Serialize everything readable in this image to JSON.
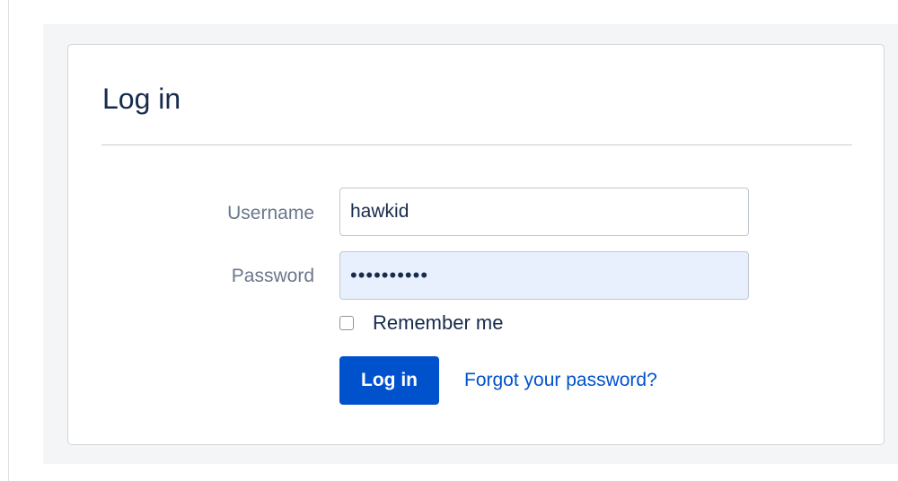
{
  "login": {
    "title": "Log in",
    "username_label": "Username",
    "username_value": "hawkid",
    "password_label": "Password",
    "password_value": "••••••••••",
    "remember_label": "Remember me",
    "remember_checked": false,
    "submit_label": "Log in",
    "forgot_link": "Forgot your password?"
  },
  "colors": {
    "primary": "#0052cc",
    "background": "#f4f5f7",
    "autofill": "#e8f0fe"
  }
}
